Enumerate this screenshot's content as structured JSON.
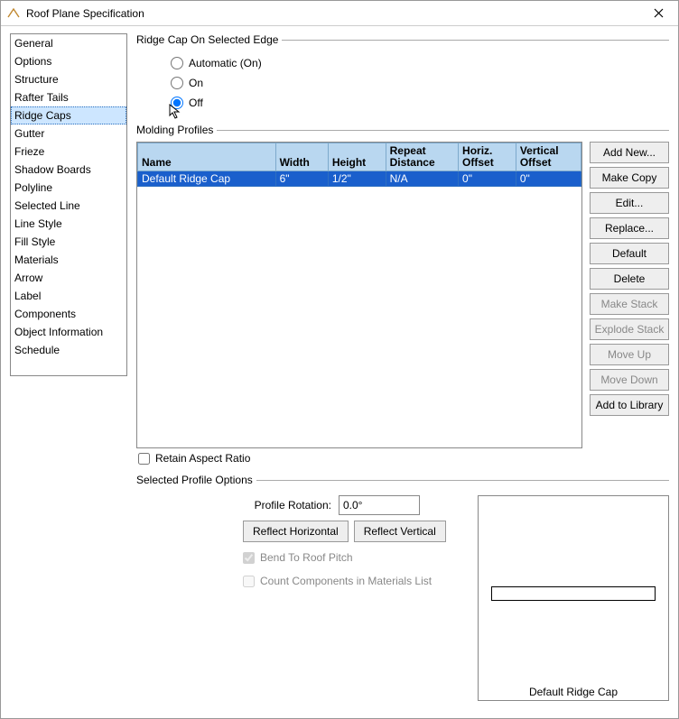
{
  "window": {
    "title": "Roof Plane Specification"
  },
  "nav": {
    "items": [
      "General",
      "Options",
      "Structure",
      "Rafter Tails",
      "Ridge Caps",
      "Gutter",
      "Frieze",
      "Shadow Boards",
      "Polyline",
      "Selected Line",
      "Line Style",
      "Fill Style",
      "Materials",
      "Arrow",
      "Label",
      "Components",
      "Object Information",
      "Schedule"
    ],
    "selected_index": 4
  },
  "ridge_cap": {
    "legend": "Ridge Cap On Selected Edge",
    "options": [
      "Automatic (On)",
      "On",
      "Off"
    ],
    "selected_index": 2
  },
  "molding": {
    "legend": "Molding Profiles",
    "columns": {
      "name": "Name",
      "width": "Width",
      "height": "Height",
      "repeat_top": "Repeat",
      "repeat_bot": "Distance",
      "horiz_top": "Horiz.",
      "horiz_bot": "Offset",
      "vert_top": "Vertical",
      "vert_bot": "Offset"
    },
    "rows": [
      {
        "name": "Default Ridge Cap",
        "width": "6\"",
        "height": "1/2\"",
        "repeat": "N/A",
        "horiz": "0\"",
        "vert": "0\""
      }
    ],
    "buttons": {
      "add_new": "Add New...",
      "make_copy": "Make Copy",
      "edit": "Edit...",
      "replace": "Replace...",
      "default": "Default",
      "delete": "Delete",
      "make_stack": "Make Stack",
      "explode_stack": "Explode Stack",
      "move_up": "Move Up",
      "move_down": "Move Down",
      "add_library": "Add to Library"
    },
    "retain_label": "Retain Aspect Ratio"
  },
  "spo": {
    "legend": "Selected Profile Options",
    "rotation_label": "Profile Rotation:",
    "rotation_value": "0.0°",
    "reflect_h": "Reflect Horizontal",
    "reflect_v": "Reflect Vertical",
    "bend_label": "Bend To Roof Pitch",
    "count_label": "Count Components in Materials List",
    "preview_caption": "Default Ridge Cap"
  }
}
